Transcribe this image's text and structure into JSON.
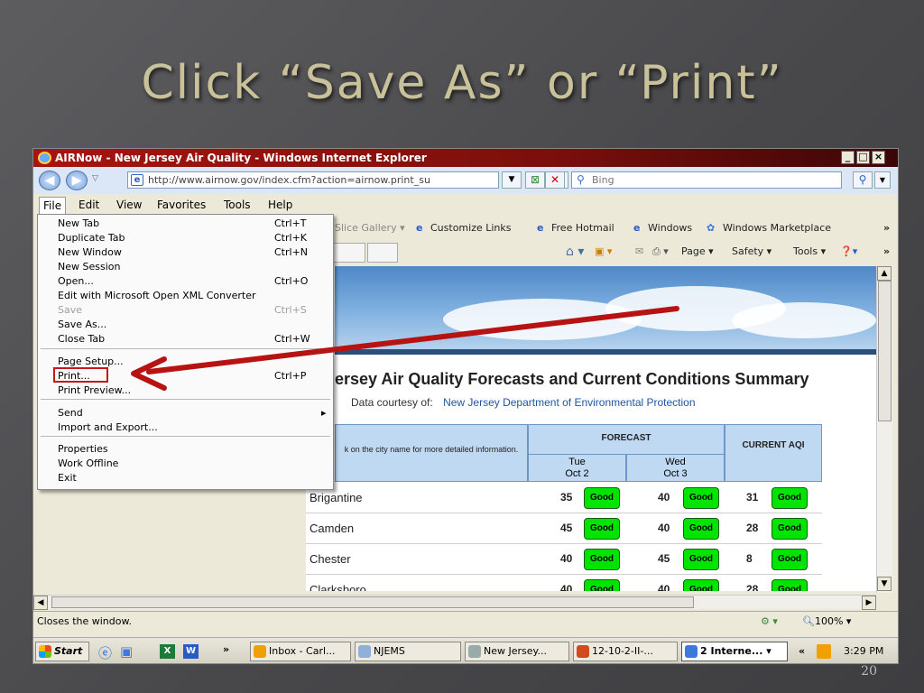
{
  "slide": {
    "title": "Click “Save As” or “Print”",
    "number": "20"
  },
  "window": {
    "title": "AIRNow - New Jersey Air Quality - Windows Internet Explorer",
    "address": "http://www.airnow.gov/index.cfm?action=airnow.print_su",
    "search_placeholder": "Bing"
  },
  "menubar": [
    "File",
    "Edit",
    "View",
    "Favorites",
    "Tools",
    "Help"
  ],
  "favorites": {
    "slice_gallery": "Slice Gallery",
    "customize_links": "Customize Links",
    "free_hotmail": "Free Hotmail",
    "windows": "Windows",
    "windows_marketplace": "Windows Marketplace"
  },
  "commands": {
    "page": "Page",
    "safety": "Safety",
    "tools": "Tools"
  },
  "file_menu": [
    {
      "label": "New Tab",
      "shortcut": "Ctrl+T"
    },
    {
      "label": "Duplicate Tab",
      "shortcut": "Ctrl+K"
    },
    {
      "label": "New Window",
      "shortcut": "Ctrl+N"
    },
    {
      "label": "New Session",
      "shortcut": ""
    },
    {
      "label": "Open...",
      "shortcut": "Ctrl+O"
    },
    {
      "label": "Edit with Microsoft Open XML Converter",
      "shortcut": ""
    },
    {
      "label": "Save",
      "shortcut": "Ctrl+S"
    },
    {
      "label": "Save As...",
      "shortcut": ""
    },
    {
      "label": "Close Tab",
      "shortcut": "Ctrl+W"
    },
    {
      "label": "Page Setup...",
      "shortcut": ""
    },
    {
      "label": "Print...",
      "shortcut": "Ctrl+P"
    },
    {
      "label": "Print Preview...",
      "shortcut": ""
    },
    {
      "label": "Send",
      "shortcut": "▸"
    },
    {
      "label": "Import and Export...",
      "shortcut": ""
    },
    {
      "label": "Properties",
      "shortcut": ""
    },
    {
      "label": "Work Offline",
      "shortcut": ""
    },
    {
      "label": "Exit",
      "shortcut": ""
    }
  ],
  "page": {
    "heading": "ersey Air Quality Forecasts and Current Conditions Summary",
    "courtesy_label": "Data courtesy of:",
    "courtesy_org": "New Jersey Department of Environmental Protection",
    "table": {
      "instruction": "k on the city name for more detailed information.",
      "forecast": "FORECAST",
      "current_aqi": "CURRENT AQI",
      "day1_name": "Tue",
      "day1_date": "Oct 2",
      "day2_name": "Wed",
      "day2_date": "Oct 3",
      "rows": [
        {
          "city": "Brigantine",
          "d1": "35",
          "d1s": "Good",
          "d2": "40",
          "d2s": "Good",
          "cur": "31",
          "curs": "Good"
        },
        {
          "city": "Camden",
          "d1": "45",
          "d1s": "Good",
          "d2": "40",
          "d2s": "Good",
          "cur": "28",
          "curs": "Good"
        },
        {
          "city": "Chester",
          "d1": "40",
          "d1s": "Good",
          "d2": "45",
          "d2s": "Good",
          "cur": "8",
          "curs": "Good"
        },
        {
          "city": "Clarksboro",
          "d1": "40",
          "d1s": "Good",
          "d2": "40",
          "d2s": "Good",
          "cur": "28",
          "curs": "Good"
        }
      ]
    }
  },
  "status": {
    "text": "Closes the window.",
    "zoom": "100%"
  },
  "taskbar": {
    "start": "Start",
    "items": [
      "Inbox - Carl...",
      "NJEMS",
      "New Jersey...",
      "12-10-2-II-...",
      "2 Interne..."
    ],
    "time": "3:29 PM"
  }
}
